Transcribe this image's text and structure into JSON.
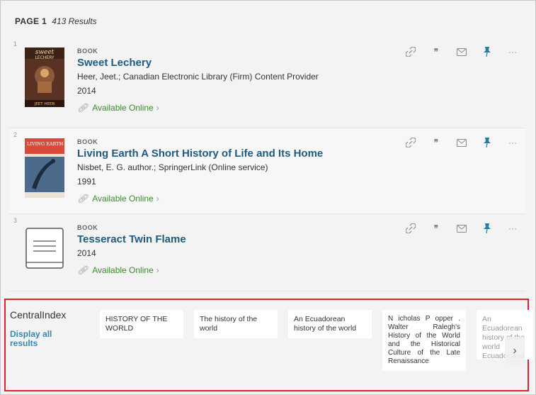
{
  "header": {
    "page_label": "PAGE 1",
    "results": "413 Results"
  },
  "results": [
    {
      "index": "1",
      "type": "BOOK",
      "title": "Sweet Lechery",
      "authors": "Heer, Jeet.; Canadian Electronic Library (Firm) Content Provider",
      "year": "2014",
      "availability": "Available Online",
      "cover_text": {
        "top": "sweet",
        "mid": "LECHERY",
        "bottom": "JEET HEER"
      }
    },
    {
      "index": "2",
      "type": "BOOK",
      "title": "Living Earth A Short History of Life and Its Home",
      "authors": "Nisbet, E. G. author.; SpringerLink (Online service)",
      "year": "1991",
      "availability": "Available Online",
      "cover_text": {
        "top": "LIVING EARTH"
      }
    },
    {
      "index": "3",
      "type": "BOOK",
      "title": "Tesseract Twin Flame",
      "year": "2014",
      "availability": "Available Online"
    }
  ],
  "actions": {
    "link": "link-icon",
    "cite": "quote-icon",
    "email": "envelope-icon",
    "pin": "pin-icon",
    "more": "more-icon"
  },
  "central_index": {
    "title": "CentralIndex",
    "display_all": "Display all results",
    "items": [
      "HISTORY OF THE WORLD",
      "The history of the world",
      "An Ecuadorean history of the world",
      "N icholas P opper . Walter Ralegh's History of the World and the Historical Culture of the Late Renaissance",
      "An Ecuadorean history of the world Ecuador and J Assange"
    ]
  },
  "colors": {
    "title": "#1e5b7f",
    "available": "#3c8a2e",
    "pin": "#1f7fa8",
    "highlight_box": "#e0222a"
  }
}
